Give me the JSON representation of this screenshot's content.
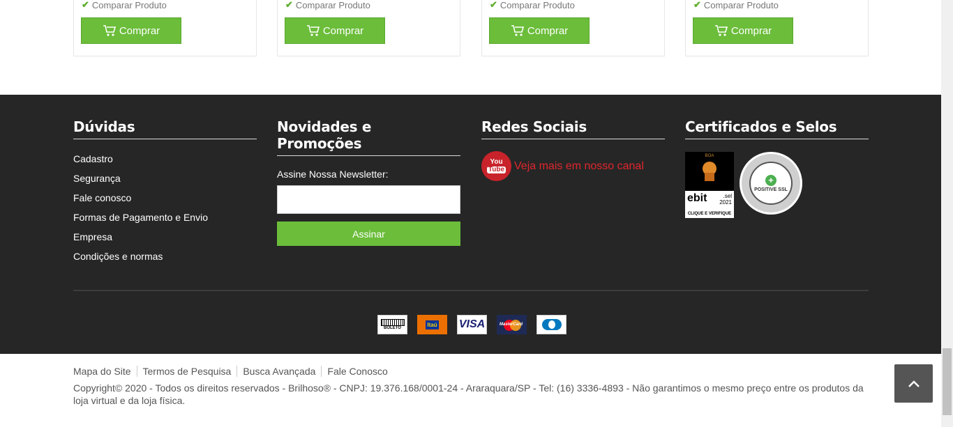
{
  "products": {
    "compare_label": "Comparar Produto",
    "buy_label": "Comprar",
    "cards": [
      {
        "compare": "Comparar Produto",
        "buy": "Comprar"
      },
      {
        "compare": "Comparar Produto",
        "buy": "Comprar"
      },
      {
        "compare": "Comparar Produto",
        "buy": "Comprar"
      },
      {
        "compare": "Comparar Produto",
        "buy": "Comprar"
      }
    ]
  },
  "footer": {
    "help": {
      "title": "Dúvidas",
      "links": [
        "Cadastro",
        "Segurança",
        "Fale conosco",
        "Formas de Pagamento e Envio",
        "Empresa",
        "Condições e normas"
      ]
    },
    "newsletter": {
      "title": "Novidades e Promoções",
      "label": "Assine Nossa Newsletter:",
      "input_value": "",
      "button": "Assinar"
    },
    "social": {
      "title": "Redes Sociais",
      "youtube_text": "Veja mais em nosso canal",
      "icon_top": "You",
      "icon_bottom": "Tube"
    },
    "seals": {
      "title": "Certificados e Selos",
      "ebit": {
        "rating": "BOA",
        "brand": "ebit",
        "year": "2021",
        "sub": ".sel",
        "cta": "CLIQUE E VERIFIQUE"
      },
      "ssl": {
        "text": "POSITIVE SSL"
      }
    },
    "payments": [
      {
        "name": "boleto",
        "label": "BOLETO"
      },
      {
        "name": "itau",
        "label": "Itaú"
      },
      {
        "name": "visa",
        "label": "VISA"
      },
      {
        "name": "mastercard",
        "label": "MasterCard"
      },
      {
        "name": "diners",
        "label": ""
      }
    ]
  },
  "bottom": {
    "links": [
      "Mapa do Site",
      "Termos de Pesquisa",
      "Busca Avançada",
      "Fale Conosco"
    ],
    "copyright": "Copyright© 2020 - Todos os direitos reservados - Brilhoso® - CNPJ: 19.376.168/0001-24 - Araraquara/SP - Tel: (16) 3336-4893 - Não garantimos o mesmo preço entre os produtos da loja virtual e da loja física."
  },
  "colors": {
    "accent": "#6bbd3a",
    "footer_bg": "#262626",
    "youtube": "#e0262d"
  }
}
